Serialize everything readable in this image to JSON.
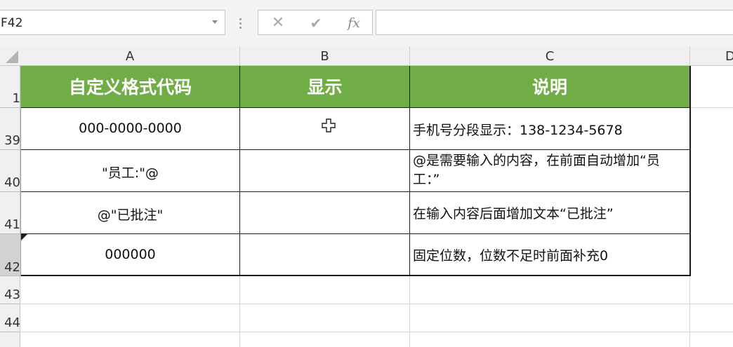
{
  "formula_bar": {
    "name_box": "F42",
    "cancel_icon": "✕",
    "enter_icon": "✔",
    "fx_label": "fx",
    "formula": ""
  },
  "columns": [
    "A",
    "B",
    "C",
    "D"
  ],
  "rows": [
    "1",
    "39",
    "40",
    "41",
    "42",
    "43",
    "44"
  ],
  "table": {
    "headers": [
      "自定义格式代码",
      "显示",
      "说明"
    ],
    "rows": [
      {
        "code": "000-0000-0000",
        "display": "",
        "desc": "手机号分段显示：138-1234-5678"
      },
      {
        "code": "\"员工:\"@",
        "display": "",
        "desc": "@是需要输入的内容，在前面自动增加“员工：”"
      },
      {
        "code": "@\"已批注\"",
        "display": "",
        "desc": "在输入内容后面增加文本“已批注”"
      },
      {
        "code": "000000",
        "display": "",
        "desc": "固定位数，位数不足时前面补充0"
      }
    ]
  },
  "colors": {
    "header_green": "#70ad47",
    "border": "#1a1a1a"
  }
}
